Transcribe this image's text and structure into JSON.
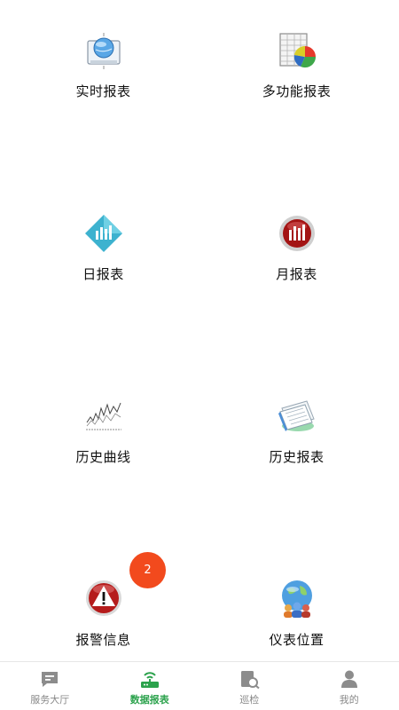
{
  "menu": [
    {
      "label": "实时报表",
      "icon": "globe-report-icon"
    },
    {
      "label": "多功能报表",
      "icon": "spreadsheet-pie-icon"
    },
    {
      "label": "日报表",
      "icon": "diamond-bars-icon"
    },
    {
      "label": "月报表",
      "icon": "red-bars-icon"
    },
    {
      "label": "历史曲线",
      "icon": "line-graph-icon"
    },
    {
      "label": "历史报表",
      "icon": "stacked-papers-icon"
    },
    {
      "label": "报警信息",
      "icon": "warning-icon"
    },
    {
      "label": "仪表位置",
      "icon": "globe-users-icon"
    }
  ],
  "alarm_badge": "2",
  "tabs": [
    {
      "label": "服务大厅",
      "icon": "message-icon",
      "active": false
    },
    {
      "label": "数据报表",
      "icon": "router-icon",
      "active": true
    },
    {
      "label": "巡检",
      "icon": "inspect-icon",
      "active": false
    },
    {
      "label": "我的",
      "icon": "person-icon",
      "active": false
    }
  ],
  "colors": {
    "accent": "#2ba24c",
    "badge": "#f24a1d",
    "tab_inactive": "#888888"
  }
}
